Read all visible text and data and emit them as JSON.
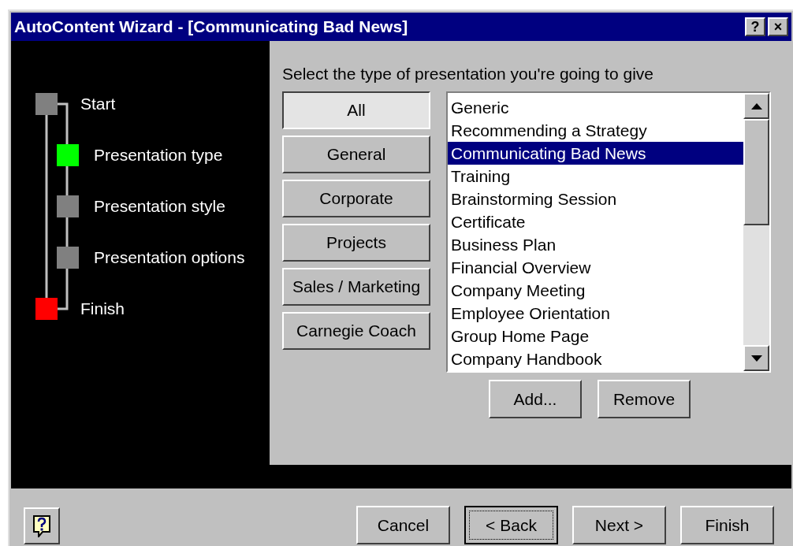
{
  "window": {
    "title": "AutoContent Wizard - [Communicating Bad News]",
    "title_buttons": [
      "?",
      "×"
    ]
  },
  "steps": [
    {
      "label": "Start",
      "kind": "main",
      "color": "#808080"
    },
    {
      "label": "Presentation type",
      "kind": "sub",
      "color": "#00ff00"
    },
    {
      "label": "Presentation style",
      "kind": "sub",
      "color": "#808080"
    },
    {
      "label": "Presentation options",
      "kind": "sub",
      "color": "#808080"
    },
    {
      "label": "Finish",
      "kind": "main",
      "color": "#ff0000"
    }
  ],
  "prompt": "Select the type of presentation you're going to give",
  "categories": [
    {
      "label": "All",
      "selected": true
    },
    {
      "label": "General",
      "selected": false
    },
    {
      "label": "Corporate",
      "selected": false
    },
    {
      "label": "Projects",
      "selected": false
    },
    {
      "label": "Sales / Marketing",
      "selected": false
    },
    {
      "label": "Carnegie Coach",
      "selected": false
    }
  ],
  "presentations": [
    {
      "label": "Generic",
      "selected": false
    },
    {
      "label": "Recommending a Strategy",
      "selected": false
    },
    {
      "label": "Communicating Bad News",
      "selected": true
    },
    {
      "label": "Training",
      "selected": false
    },
    {
      "label": "Brainstorming Session",
      "selected": false
    },
    {
      "label": "Certificate",
      "selected": false
    },
    {
      "label": "Business Plan",
      "selected": false
    },
    {
      "label": "Financial Overview",
      "selected": false
    },
    {
      "label": "Company Meeting",
      "selected": false
    },
    {
      "label": "Employee Orientation",
      "selected": false
    },
    {
      "label": "Group Home Page",
      "selected": false
    },
    {
      "label": "Company Handbook",
      "selected": false
    }
  ],
  "list_buttons": [
    "Add...",
    "Remove"
  ],
  "footer_buttons": [
    {
      "label": "Cancel",
      "focused": false
    },
    {
      "label": "< Back",
      "focused": true
    },
    {
      "label": "Next >",
      "focused": false
    },
    {
      "label": "Finish",
      "focused": false
    }
  ]
}
